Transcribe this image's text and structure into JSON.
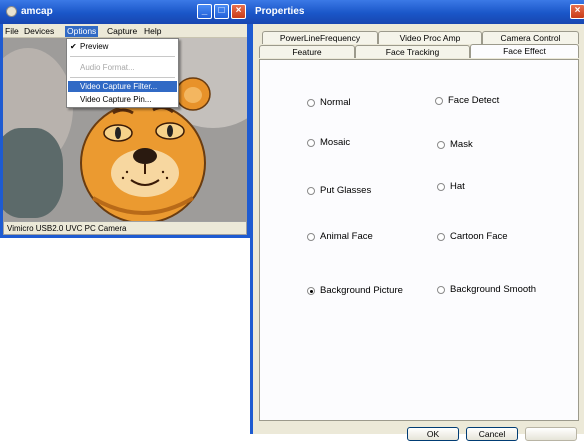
{
  "amcap": {
    "title": "amcap",
    "menu": [
      "File",
      "Devices",
      "Options",
      "Capture",
      "Help"
    ],
    "options_menu": {
      "items": [
        {
          "label": "Preview",
          "checked": true,
          "disabled": false
        },
        {
          "label": "Audio Format...",
          "checked": false,
          "disabled": true
        },
        {
          "label": "Video Capture Filter...",
          "checked": false,
          "disabled": false,
          "highlighted": true
        },
        {
          "label": "Video Capture Pin...",
          "checked": false,
          "disabled": false
        }
      ]
    },
    "status": "Vimicro USB2.0 UVC PC Camera"
  },
  "properties": {
    "title": "Properties",
    "tabs_row1": [
      "PowerLineFrequency",
      "Video Proc Amp",
      "Camera Control"
    ],
    "tabs_row2": [
      "Feature",
      "Face Tracking",
      "Face Effect"
    ],
    "active_tab": "Face Effect",
    "options": [
      {
        "label": "Normal",
        "checked": false
      },
      {
        "label": "Face Detect",
        "checked": false
      },
      {
        "label": "Mosaic",
        "checked": false
      },
      {
        "label": "Mask",
        "checked": false
      },
      {
        "label": "Put Glasses",
        "checked": false
      },
      {
        "label": "Hat",
        "checked": false
      },
      {
        "label": "Animal Face",
        "checked": false
      },
      {
        "label": "Cartoon Face",
        "checked": false
      },
      {
        "label": "Background Picture",
        "checked": true
      },
      {
        "label": "Background Smooth",
        "checked": false
      }
    ],
    "buttons": [
      "OK",
      "Cancel"
    ]
  },
  "colors": {
    "titlebar": "#1a56c8",
    "dialog_bg": "#ece9d8",
    "menu_highlight": "#316ac5"
  }
}
